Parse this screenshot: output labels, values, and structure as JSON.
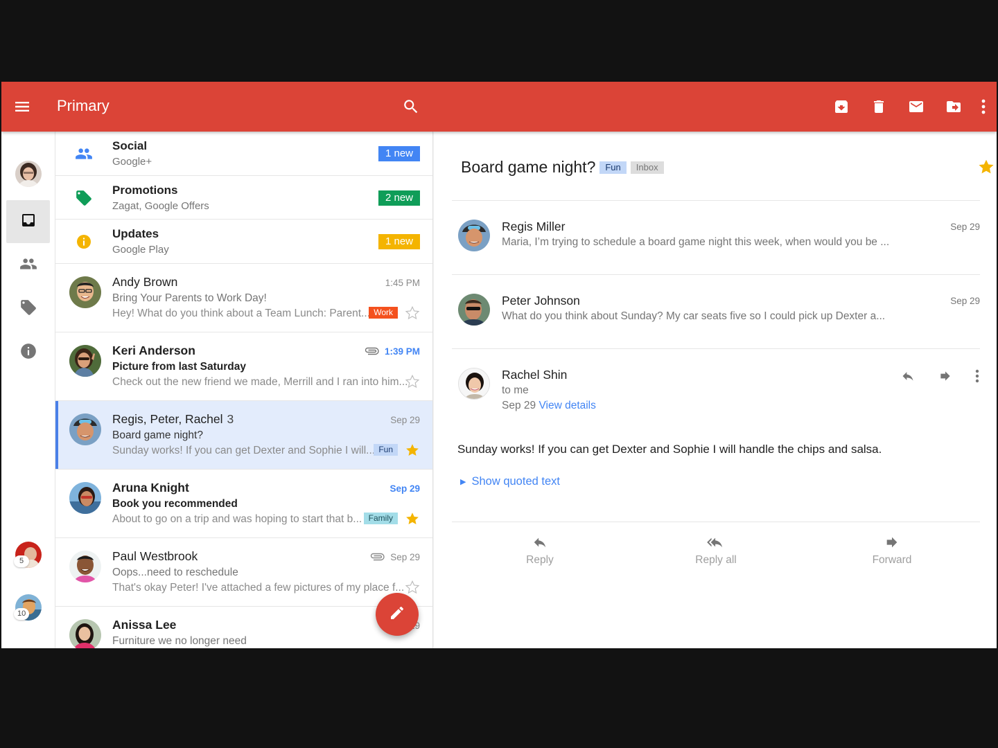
{
  "appbar": {
    "title": "Primary",
    "color": "#db4437",
    "actions": [
      "archive-icon",
      "delete-icon",
      "mark-unread-icon",
      "move-to-icon",
      "more-vert-icon"
    ]
  },
  "rail": {
    "nav": [
      {
        "name": "inbox",
        "icon": "inbox-icon",
        "active": true
      },
      {
        "name": "social",
        "icon": "people-icon",
        "active": false
      },
      {
        "name": "promotions",
        "icon": "label-icon",
        "active": false
      },
      {
        "name": "updates",
        "icon": "info-icon",
        "active": false
      }
    ],
    "accounts": [
      {
        "count": "5"
      },
      {
        "count": "10"
      }
    ]
  },
  "categories": [
    {
      "name": "Social",
      "sub": "Google+",
      "badge": "1 new",
      "color": "#4285f4",
      "icon": "people-icon"
    },
    {
      "name": "Promotions",
      "sub": "Zagat, Google Offers",
      "badge": "2 new",
      "color": "#0f9d58",
      "icon": "tag-icon"
    },
    {
      "name": "Updates",
      "sub": "Google Play",
      "badge": "1 new",
      "color": "#f4b400",
      "icon": "info-icon"
    }
  ],
  "mails": [
    {
      "sender": "Andy Brown",
      "count": "",
      "subject": "Bring Your Parents to Work Day!",
      "snippet": "Hey! What do you think about a Team Lunch: Parent...",
      "time": "1:45 PM",
      "label": "Work",
      "label_bg": "#f4511e",
      "label_fg": "#ffffff",
      "starred": false,
      "unread": false,
      "attachment": false,
      "selected": false
    },
    {
      "sender": "Keri Anderson",
      "count": "",
      "subject": "Picture from last Saturday",
      "snippet": "Check out the new friend we made, Merrill and I ran into him...",
      "time": "1:39 PM",
      "label": "",
      "starred": false,
      "unread": true,
      "attachment": true,
      "selected": false
    },
    {
      "sender": "Regis, Peter, Rachel",
      "count": "3",
      "subject": "Board game night?",
      "snippet": "Sunday works! If you can get Dexter and Sophie I will...",
      "time": "Sep 29",
      "label": "Fun",
      "label_bg": "#c2d7f7",
      "label_fg": "#1a3a6e",
      "starred": true,
      "unread": false,
      "attachment": false,
      "selected": true
    },
    {
      "sender": "Aruna Knight",
      "count": "",
      "subject": "Book you recommended",
      "snippet": "About to go on a trip and was hoping to start that b...",
      "time": "Sep 29",
      "label": "Family",
      "label_bg": "#a3dde8",
      "label_fg": "#1d4f5a",
      "starred": true,
      "unread": true,
      "attachment": false,
      "selected": false
    },
    {
      "sender": "Paul Westbrook",
      "count": "",
      "subject": "Oops...need to reschedule",
      "snippet": "That's okay Peter! I've attached a few pictures of my place f...",
      "time": "Sep 29",
      "label": "",
      "starred": false,
      "unread": false,
      "attachment": true,
      "selected": false
    },
    {
      "sender": "Anissa Lee",
      "count": "",
      "subject": "Furniture we no longer need",
      "snippet": "",
      "time": "Sep 29",
      "label": "",
      "starred": false,
      "unread": true,
      "attachment": false,
      "selected": false
    }
  ],
  "detail": {
    "subject": "Board game night?",
    "tags": [
      {
        "text": "Fun",
        "bg": "#c2d7f7",
        "fg": "#1a3a6e"
      },
      {
        "text": "Inbox",
        "bg": "#dddddd",
        "fg": "#777777"
      }
    ],
    "starred": true,
    "messages": [
      {
        "from": "Regis Miller",
        "preview": "Maria, I’m trying to schedule a board game night this week, when would you be ...",
        "date": "Sep 29"
      },
      {
        "from": "Peter Johnson",
        "preview": "What do you think about Sunday? My car seats five so I could pick up Dexter a...",
        "date": "Sep 29"
      }
    ],
    "open_message": {
      "from": "Rachel Shin",
      "to": "to me",
      "date": "Sep 29",
      "view_details": "View details",
      "body": "Sunday works! If you can get Dexter and Sophie I will handle the chips and salsa.",
      "show_quoted": "Show quoted text"
    },
    "actions": {
      "reply": "Reply",
      "reply_all": "Reply all",
      "forward": "Forward"
    }
  },
  "fab": {
    "icon": "pencil-icon"
  }
}
